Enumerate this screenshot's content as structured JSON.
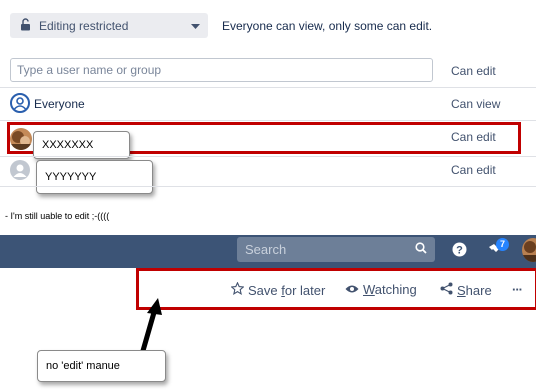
{
  "restrictions": {
    "select_value": "Editing restricted",
    "description": "Everyone can view, only some can edit."
  },
  "user_search": {
    "placeholder": "Type a user name or group",
    "permission": "Can edit"
  },
  "rows": [
    {
      "name": "Everyone",
      "permission": "Can view"
    },
    {
      "name": "XXXXXXX",
      "permission": "Can edit"
    },
    {
      "name": "YYYYYYY",
      "permission": "Can edit"
    }
  ],
  "note": "- I'm still uable to edit ;-((((",
  "topbar": {
    "search_placeholder": "Search",
    "notification_count": "7"
  },
  "page_actions": {
    "save_prefix": "Save ",
    "save_underlined": "f",
    "save_suffix": "or later",
    "watching_underlined": "W",
    "watching_rest": "atching",
    "share_underlined": "S",
    "share_rest": "hare",
    "more": "···"
  },
  "annotation": "no 'edit' manue",
  "colors": {
    "topbar": "#3c5476",
    "highlight": "#c00000"
  }
}
